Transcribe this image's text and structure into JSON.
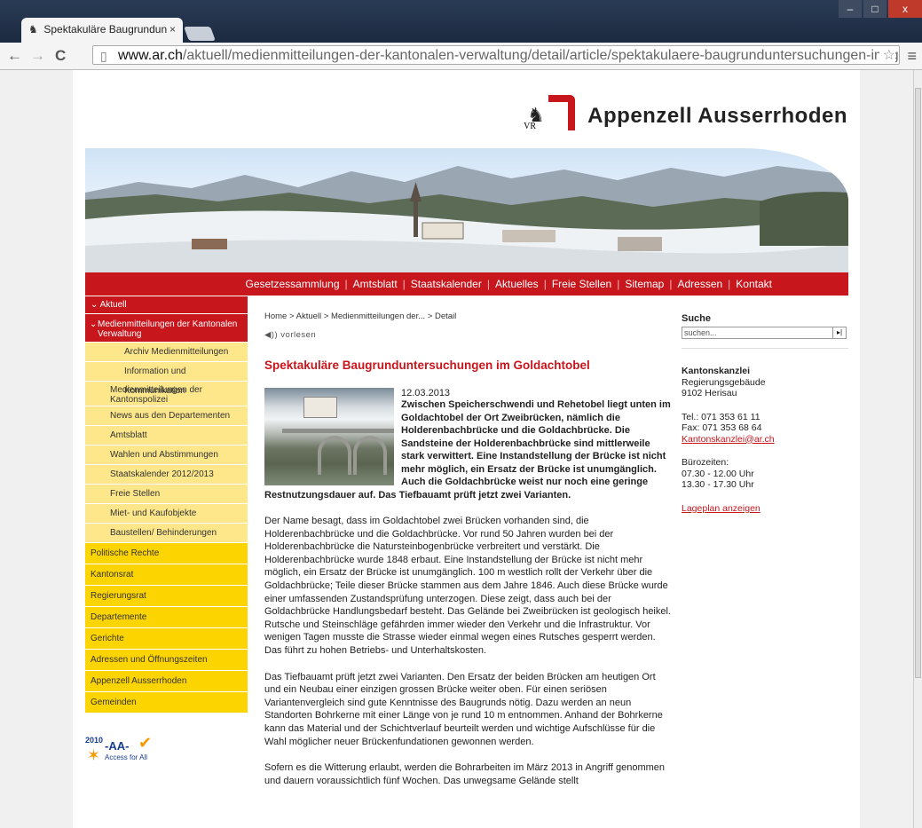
{
  "browser": {
    "tab_title": "Spektakuläre Baugrundun",
    "tab_close": "×",
    "url_host": "www.ar.ch",
    "url_path": "/aktuell/medienmitteilungen-der-kantonalen-verwaltung/detail/article/spektakulaere-baugrunduntersuchungen-im-goldachtobel/",
    "back_icon": "←",
    "forward_icon": "→",
    "reload_icon": "C",
    "bookmark_icon": "☆",
    "menu_icon": "≡"
  },
  "site": {
    "logo_text": "Appenzell Ausserrhoden",
    "logo_letters": "VR",
    "accent": "#c8161d",
    "nav_yellow": "#fcd400",
    "nav_light_yellow": "#fde78a"
  },
  "topnav": [
    "Gesetzessammlung",
    "Amtsblatt",
    "Staatskalender",
    "Aktuelles",
    "Freie Stellen",
    "Sitemap",
    "Adressen",
    "Kontakt"
  ],
  "sidebar": {
    "top": "Aktuell",
    "sub": "Medienmitteilungen der Kantonalen Verwaltung",
    "level2": [
      "Archiv Medienmitteilungen",
      "Information und Kommunikation"
    ],
    "level1": [
      "Medienmitteilungen der Kantonspolizei",
      "News aus den Departementen",
      "Amtsblatt",
      "Wahlen und Abstimmungen",
      "Staatskalender 2012/2013",
      "Freie Stellen",
      "Miet- und Kaufobjekte",
      "Baustellen/ Behinderungen"
    ],
    "level0": [
      "Politische Rechte",
      "Kantonsrat",
      "Regierungsrat",
      "Departemente",
      "Gerichte",
      "Adressen und Öffnungszeiten",
      "Appenzell Ausserrhoden",
      "Gemeinden"
    ]
  },
  "badge": {
    "year": "2010",
    "label": "-AA-",
    "sub": "Access for All"
  },
  "article": {
    "breadcrumb": "Home > Aktuell > Medienmitteilungen der... > Detail",
    "vorlesen": "vorlesen",
    "title": "Spektakuläre Baugrunduntersuchungen im Goldachtobel",
    "date": "12.03.2013",
    "lead": "Zwischen Speicherschwendi und Rehetobel liegt unten im Goldachtobel der Ort Zweibrücken, nämlich die Holderenbachbrücke und die Goldachbrücke. Die Sandsteine der Holderenbachbrücke sind mittlerweile stark verwittert. Eine Instandstellung der Brücke ist nicht mehr möglich, ein Ersatz der Brücke ist unumgänglich. Auch die Goldachbrücke weist nur noch eine geringe Restnutzungsdauer auf. Das Tiefbauamt prüft jetzt zwei Varianten.",
    "p1": "Der Name besagt, dass im Goldachtobel zwei Brücken vorhanden sind, die Holderenbachbrücke und die Goldachbrücke. Vor rund 50 Jahren wurden bei der Holderenbachbrücke die Natursteinbogenbrücke verbreitert und verstärkt. Die Holderenbachbrücke wurde 1848 erbaut. Eine Instandstellung der Brücke ist nicht mehr möglich, ein Ersatz der Brücke ist unumgänglich. 100 m westlich rollt der Verkehr über die Goldachbrücke; Teile dieser Brücke stammen aus dem Jahre 1846. Auch diese Brücke wurde einer umfassenden Zustandsprüfung unterzogen. Diese zeigt, dass auch bei der Goldachbrücke Handlungsbedarf besteht. Das Gelände bei Zweibrücken ist geologisch heikel. Rutsche und Steinschläge gefährden immer wieder den Verkehr und die Infrastruktur. Vor wenigen Tagen musste die Strasse wieder einmal wegen eines Rutsches gesperrt werden. Das führt zu hohen Betriebs- und Unterhaltskosten.",
    "p2": "Das Tiefbauamt prüft jetzt zwei Varianten. Den Ersatz der beiden Brücken am heutigen Ort und ein Neubau einer einzigen grossen Brücke weiter oben. Für einen seriösen Variantenvergleich sind gute Kenntnisse des Baugrunds nötig. Dazu werden an neun Standorten Bohrkerne mit einer Länge von je rund 10 m entnommen. Anhand der Bohrkerne kann das Material und der Schichtverlauf beurteilt werden und wichtige Aufschlüsse für die Wahl möglicher neuer Brückenfundationen gewonnen werden.",
    "p3": "Sofern es die Witterung erlaubt, werden die Bohrarbeiten im März 2013 in Angriff genommen und dauern voraussichtlich fünf Wochen. Das unwegsame Gelände stellt"
  },
  "right": {
    "search_heading": "Suche",
    "search_placeholder": "suchen...",
    "search_button": "▸|",
    "org": "Kantonskanzlei",
    "addr1": "Regierungsgebäude",
    "addr2": "9102 Herisau",
    "tel": "Tel.: 071 353 61 11",
    "fax": "Fax: 071 353 68 64",
    "email": "Kantonskanzlei@ar.ch",
    "hours_label": "Bürozeiten:",
    "hours1": "07.30 - 12.00 Uhr",
    "hours2": "13.30 - 17.30 Uhr",
    "map_link": "Lageplan anzeigen"
  }
}
